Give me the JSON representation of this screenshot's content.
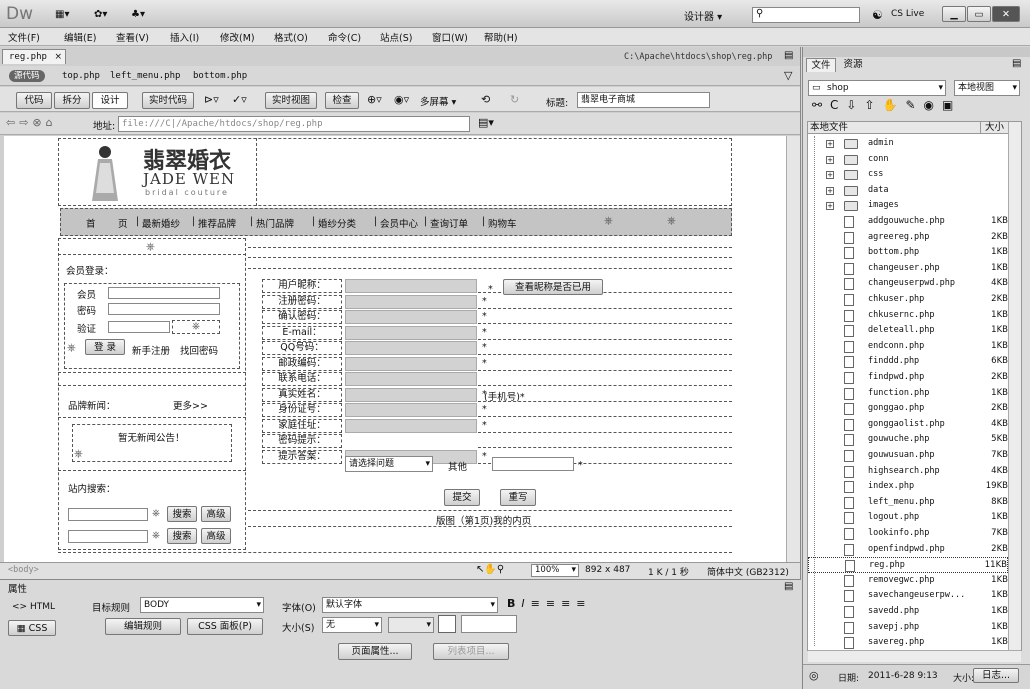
{
  "app": {
    "logo": "Dw",
    "workspace": "设计器",
    "cslive": "CS Live"
  },
  "menu": [
    "文件(F)",
    "编辑(E)",
    "查看(V)",
    "插入(I)",
    "修改(M)",
    "格式(O)",
    "命令(C)",
    "站点(S)",
    "窗口(W)",
    "帮助(H)"
  ],
  "doc": {
    "tab": "reg.php",
    "path": "C:\\Apache\\htdocs\\shop\\reg.php",
    "source_label": "源代码",
    "related": [
      "top.php",
      "left_menu.php",
      "bottom.php"
    ]
  },
  "toolbar": {
    "code": "代码",
    "split": "拆分",
    "design": "设计",
    "live_code": "实时代码",
    "live_view": "实时视图",
    "inspect": "检查",
    "multiscreen": "多屏幕",
    "title_label": "标题:",
    "title_value": "翡翠电子商城"
  },
  "address": {
    "label": "地址:",
    "value": "file:///C|/Apache/htdocs/shop/reg.php"
  },
  "site": {
    "logo_cn": "翡翠婚衣",
    "logo_en": "JADE WEN",
    "logo_sub": "bridal couture",
    "nav": [
      "首",
      "页",
      "最新婚纱",
      "推荐品牌",
      "热门品牌",
      "婚纱分类",
      "会员中心",
      "查询订单",
      "购物车"
    ],
    "nav_seps": [
      "|",
      "|",
      "|",
      "|",
      "|",
      "|",
      "|",
      "|"
    ],
    "left": {
      "member_login": "会员登录：",
      "member": "会员",
      "password": "密码",
      "code": "验证",
      "login_btn": "登 录",
      "register": "新手注册",
      "forgot": "找回密码",
      "news": "品牌新闻：",
      "more": "更多>>",
      "no_news": "暂无新闻公告！",
      "search": "站内搜索：",
      "search_btn": "搜索",
      "advanced": "高级"
    },
    "form": {
      "labels": [
        "用户昵称：",
        "注册密码：",
        "确认密码：",
        "E-mail：",
        "QQ号码：",
        "邮政编码：",
        "联系电话：",
        "真实姓名：",
        "身份证号：",
        "家庭住址：",
        "密码提示：",
        "提示答案："
      ],
      "stars": [
        "*",
        "*",
        "*",
        "*",
        "*",
        "*",
        "*",
        "*",
        "*",
        "*"
      ],
      "check_btn": "查看昵称是否已用",
      "phone_hint": "(手机号)*",
      "question_select": "请选择问题",
      "other": "其他",
      "submit": "提交",
      "reset": "重写",
      "bottom_line": "版图（第1页)我的内页"
    }
  },
  "status": {
    "tag": "<body>",
    "zoom": "100%",
    "size": "892 x 487",
    "kb": "1 K / 1 秒",
    "encoding": "简体中文 (GB2312)"
  },
  "props": {
    "title": "属性",
    "html": "HTML",
    "css": "CSS",
    "target_rule_label": "目标规则",
    "target_rule_value": "BODY",
    "edit_rule": "编辑规则",
    "css_panel": "CSS 面板(P)",
    "font_label": "字体(O)",
    "font_value": "默认字体",
    "size_label": "大小(S)",
    "size_value": "无",
    "page_props": "页面属性...",
    "list_item": "列表项目..."
  },
  "files": {
    "tab_files": "文件",
    "tab_assets": "资源",
    "site": "shop",
    "view": "本地视图",
    "col_name": "本地文件",
    "col_size": "大小",
    "folders": [
      "admin",
      "conn",
      "css",
      "data",
      "images"
    ],
    "items": [
      {
        "name": "addgouwuche.php",
        "size": "1KB"
      },
      {
        "name": "agreereg.php",
        "size": "2KB"
      },
      {
        "name": "bottom.php",
        "size": "1KB"
      },
      {
        "name": "changeuser.php",
        "size": "1KB"
      },
      {
        "name": "changeuserpwd.php",
        "size": "4KB"
      },
      {
        "name": "chkuser.php",
        "size": "2KB"
      },
      {
        "name": "chkusernc.php",
        "size": "1KB"
      },
      {
        "name": "deleteall.php",
        "size": "1KB"
      },
      {
        "name": "endconn.php",
        "size": "1KB"
      },
      {
        "name": "finddd.php",
        "size": "6KB"
      },
      {
        "name": "findpwd.php",
        "size": "2KB"
      },
      {
        "name": "function.php",
        "size": "1KB"
      },
      {
        "name": "gonggao.php",
        "size": "2KB"
      },
      {
        "name": "gonggaolist.php",
        "size": "4KB"
      },
      {
        "name": "gouwuche.php",
        "size": "5KB"
      },
      {
        "name": "gouwusuan.php",
        "size": "7KB"
      },
      {
        "name": "highsearch.php",
        "size": "4KB"
      },
      {
        "name": "index.php",
        "size": "19KB"
      },
      {
        "name": "left_menu.php",
        "size": "8KB"
      },
      {
        "name": "logout.php",
        "size": "1KB"
      },
      {
        "name": "lookinfo.php",
        "size": "7KB"
      },
      {
        "name": "openfindpwd.php",
        "size": "2KB"
      },
      {
        "name": "reg.php",
        "size": "11KB"
      },
      {
        "name": "removegwc.php",
        "size": "1KB"
      },
      {
        "name": "savechangeuserpw...",
        "size": "1KB"
      },
      {
        "name": "savedd.php",
        "size": "1KB"
      },
      {
        "name": "savepj.php",
        "size": "1KB"
      },
      {
        "name": "savereg.php",
        "size": "1KB"
      }
    ],
    "date_label": "日期:",
    "date_value": "2011-6-28 9:13",
    "size_label": "大小:",
    "log": "日志..."
  }
}
